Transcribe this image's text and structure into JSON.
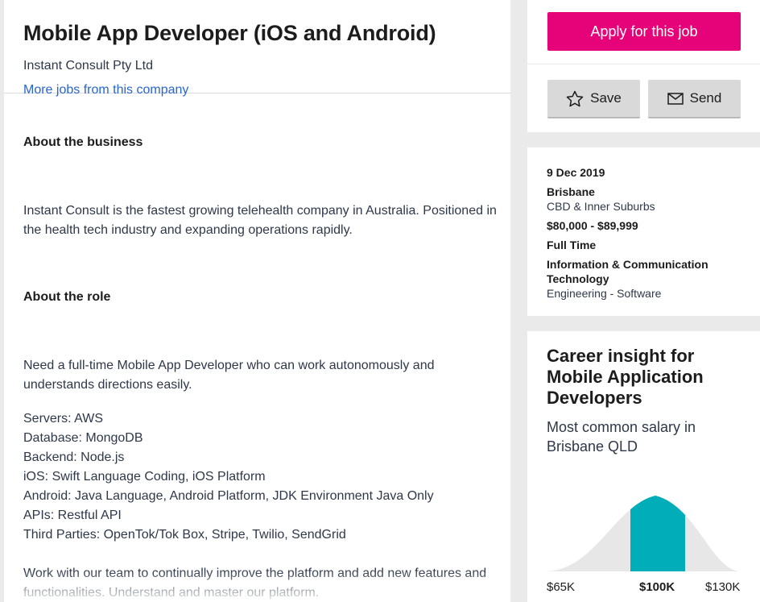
{
  "job": {
    "title": "Mobile App Developer (iOS and Android)",
    "company": "Instant Consult Pty Ltd",
    "more_jobs_link": "More jobs from this company"
  },
  "description": {
    "about_business_heading": "About the business",
    "about_business_text": "Instant Consult is the fastest growing telehealth company in Australia. Positioned in the health tech industry and expanding operations rapidly.",
    "about_role_heading": "About the role",
    "about_role_text": "Need a full-time Mobile App Developer who can work autonomously and understands directions easily.",
    "stack": [
      "Servers: AWS",
      "Database: MongoDB",
      "Backend: Node.js",
      "iOS: Swift Language Coding, iOS Platform",
      "Android: Java Language, Android Platform, JDK Environment Java Only",
      "APIs: Restful API",
      "Third Parties: OpenTok/Tok Box, Stripe, Twilio, SendGrid"
    ],
    "closing_text": "Work with our team to continually improve the platform and add new features and functionalities. Understand and master our platform."
  },
  "actions": {
    "apply_label": "Apply for this job",
    "save_label": "Save",
    "send_label": "Send"
  },
  "meta": {
    "date": "9 Dec 2019",
    "location": "Brisbane",
    "area": "CBD & Inner Suburbs",
    "salary": "$80,000 - $89,999",
    "work_type": "Full Time",
    "classification": "Information & Communication Technology",
    "subclassification": "Engineering - Software"
  },
  "insight": {
    "title": "Career insight for Mobile Application Developers",
    "subtitle": "Most common salary in Brisbane QLD",
    "salary_low": "$65K",
    "salary_mid": "$100K",
    "salary_high": "$130K"
  },
  "colors": {
    "apply": "#e60278",
    "link": "#2765cf",
    "curve_highlight": "#00adb8",
    "curve_base": "#e7e7e7"
  }
}
